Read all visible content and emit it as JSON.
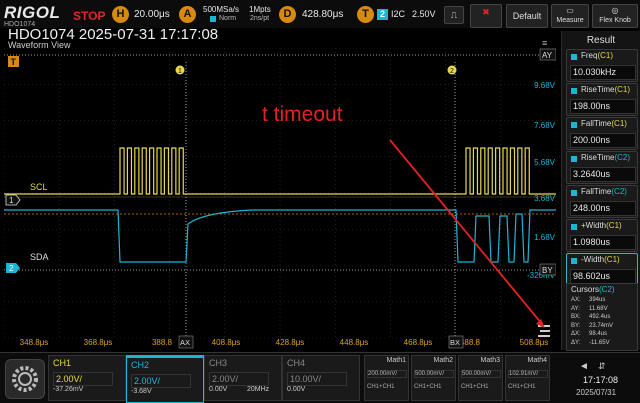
{
  "topbar": {
    "brand": "RIGOL",
    "brand_sub": "HDO1074",
    "run_state": "STOP",
    "horizontal": {
      "icon": "H",
      "value": "20.00μs"
    },
    "acquire": {
      "icon": "A",
      "rate": "500MSa/s",
      "mode": "Norm",
      "points": "1Mpts",
      "points_sub": "2ns/pt"
    },
    "delay": {
      "icon": "D",
      "value": "428.80μs"
    },
    "trigger": {
      "icon": "T",
      "source": "2",
      "type": "I2C",
      "level": "2.50V"
    },
    "buttons": [
      {
        "label": "Clear"
      },
      {
        "label": "Default"
      },
      {
        "label": "Measure"
      },
      {
        "label": "Flex Knob"
      }
    ]
  },
  "header": {
    "title": "HDO1074 2025-07-31 17:17:08",
    "view_label": "Waveform View"
  },
  "annotation": {
    "text": "t timeout",
    "color": "#e32222"
  },
  "plot": {
    "right_scale": [
      "9.68V",
      "7.68V",
      "5.68V",
      "3.68V",
      "1.68V",
      "-320mV"
    ],
    "ay_label": "AY",
    "by_label": "BY",
    "time_labels": [
      "348.8μs",
      "368.8μs",
      "388.8",
      "408.8μs",
      "428.8μs",
      "448.8μs",
      "468.8μs",
      "488.8",
      "508.8μs"
    ],
    "ax_label": "AX",
    "bx_label": "BX",
    "channel_labels": {
      "scl": "SCL",
      "sda": "SDA"
    },
    "markers": {
      "trig": "T",
      "ch1": "1",
      "ch2": "2",
      "cursor_a": "1",
      "cursor_b": "2"
    }
  },
  "result_panel": {
    "title": "Result",
    "measurements": [
      {
        "name": "Freq",
        "ch": "(C1)",
        "ch_color": "c1",
        "value": "10.030kHz"
      },
      {
        "name": "RiseTime",
        "ch": "(C1)",
        "ch_color": "c1",
        "value": "198.00ns"
      },
      {
        "name": "FallTime",
        "ch": "(C1)",
        "ch_color": "c1",
        "value": "200.00ns"
      },
      {
        "name": "RiseTime",
        "ch": "(C2)",
        "ch_color": "c2",
        "value": "3.2640us"
      },
      {
        "name": "FallTime",
        "ch": "(C2)",
        "ch_color": "c2",
        "value": "248.00ns"
      },
      {
        "name": "+Width",
        "ch": "(C1)",
        "ch_color": "c1",
        "value": "1.0980us"
      },
      {
        "name": "-Width",
        "ch": "(C1)",
        "ch_color": "c1",
        "value": "98.602us"
      }
    ],
    "cursors": {
      "title": "Cursors",
      "ch": "(C2)",
      "rows": [
        {
          "k": "AX:",
          "v": "394us"
        },
        {
          "k": "AY:",
          "v": "11.68V"
        },
        {
          "k": "BX:",
          "v": "492.4us"
        },
        {
          "k": "BY:",
          "v": "23.74mV"
        },
        {
          "k": "ΔX:",
          "v": "98.4us"
        },
        {
          "k": "ΔY:",
          "v": "-11.65V"
        }
      ]
    }
  },
  "bottombar": {
    "channels": [
      {
        "name": "CH1",
        "scale": "2.00V/",
        "offset": "-37.26mV",
        "bw": "",
        "color": "#e6d84a"
      },
      {
        "name": "CH2",
        "scale": "2.00V/",
        "offset": "-3.68V",
        "bw": "",
        "color": "#19b7d4"
      },
      {
        "name": "CH3",
        "scale": "2.00V/",
        "offset": "0.00V",
        "bw": "20MHz",
        "color": "#888888"
      },
      {
        "name": "CH4",
        "scale": "10.00V/",
        "offset": "0.00V",
        "bw": "",
        "color": "#888888"
      }
    ],
    "maths": [
      {
        "name": "Math1",
        "scale": "200.00mV/",
        "src": "CH1+CH1"
      },
      {
        "name": "Math2",
        "scale": "500.00mV/",
        "src": "CH1+CH1"
      },
      {
        "name": "Math3",
        "scale": "500.00mV/",
        "src": "CH1+CH1"
      },
      {
        "name": "Math4",
        "scale": "102.91mV/",
        "src": "CH1+CH1"
      }
    ],
    "clock": {
      "time": "17:17:08",
      "date": "2025/07/31"
    }
  },
  "colors": {
    "ch1": "#e6d84a",
    "ch2": "#19b7d4",
    "trigger": "#d88a0e",
    "arrow": "#e32222"
  }
}
